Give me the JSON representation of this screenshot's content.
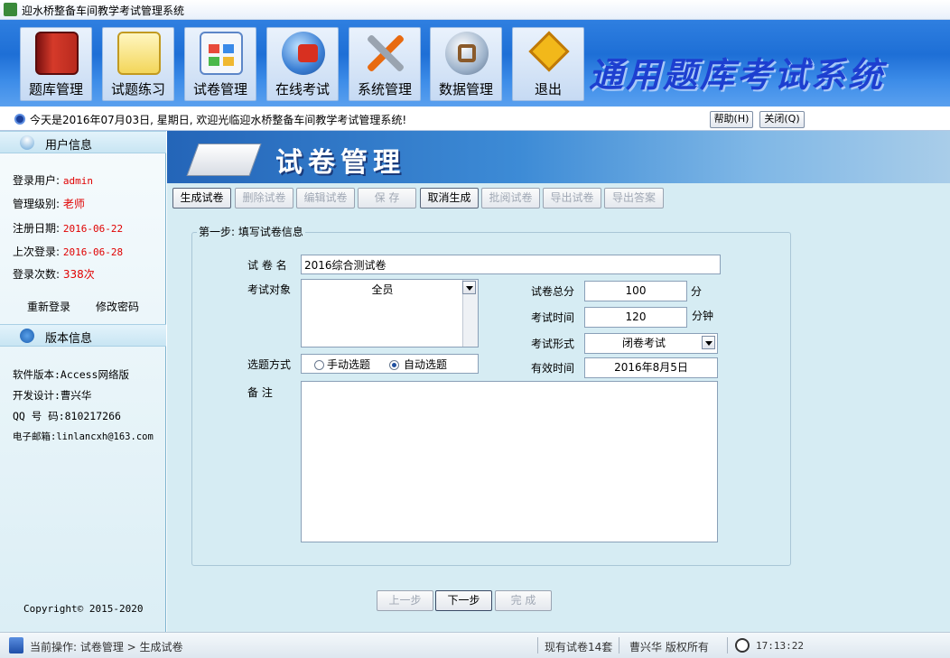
{
  "window": {
    "title": "迎水桥整备车间教学考试管理系统"
  },
  "toolbar": {
    "items": [
      {
        "label": "题库管理",
        "icon": "notebook-icon"
      },
      {
        "label": "试题练习",
        "icon": "notepad-pencil-icon"
      },
      {
        "label": "试卷管理",
        "icon": "window-grid-icon"
      },
      {
        "label": "在线考试",
        "icon": "globe-plug-icon"
      },
      {
        "label": "系统管理",
        "icon": "tools-icon"
      },
      {
        "label": "数据管理",
        "icon": "network-link-icon"
      },
      {
        "label": "退出",
        "icon": "warning-sign-icon"
      }
    ],
    "brand": "通用题库考试系统"
  },
  "infobar": {
    "message": "今天是2016年07月03日, 星期日, 欢迎光临迎水桥整备车间教学考试管理系统!",
    "help_label": "帮助(H)",
    "close_label": "关闭(Q)"
  },
  "sidebar": {
    "user_header": "用户信息",
    "user": [
      {
        "label": "登录用户:",
        "value": "admin"
      },
      {
        "label": "管理级别:",
        "value": "老师"
      },
      {
        "label": "注册日期:",
        "value": "2016-06-22"
      },
      {
        "label": "上次登录:",
        "value": "2016-06-28"
      },
      {
        "label": "登录次数:",
        "value": "338次"
      }
    ],
    "relogin": "重新登录",
    "change_password": "修改密码",
    "version_header": "版本信息",
    "version": [
      "软件版本:Access网络版",
      "开发设计:曹兴华",
      "QQ 号 码:810217266",
      "电子邮箱:linlancxh@163.com"
    ],
    "copyright": "Copyright© 2015-2020"
  },
  "banner": {
    "title": "试卷管理"
  },
  "actions": {
    "generate": "生成试卷",
    "delete": "删除试卷",
    "edit": "编辑试卷",
    "save": "保  存",
    "cancel": "取消生成",
    "review": "批阅试卷",
    "export_paper": "导出试卷",
    "export_answers": "导出答案"
  },
  "form": {
    "legend": "第一步: 填写试卷信息",
    "name_label": "试 卷 名",
    "name_value": "2016综合测试卷",
    "target_label": "考试对象",
    "target_value": "全员",
    "mode_label": "选题方式",
    "mode_manual": "手动选题",
    "mode_auto": "自动选题",
    "note_label": "备    注",
    "total_label": "试卷总分",
    "total_value": "100",
    "total_unit": "分",
    "time_label": "考试时间",
    "time_value": "120",
    "time_unit": "分钟",
    "form_label": "考试形式",
    "form_value": "闭卷考试",
    "valid_label": "有效时间",
    "valid_value": "2016年8月5日"
  },
  "wizard": {
    "prev": "上一步",
    "next": "下一步",
    "finish": "完  成"
  },
  "status": {
    "operation": "当前操作: 试卷管理 > 生成试卷",
    "count": "现有试卷14套",
    "copyright": "曹兴华  版权所有",
    "time": "17:13:22"
  }
}
